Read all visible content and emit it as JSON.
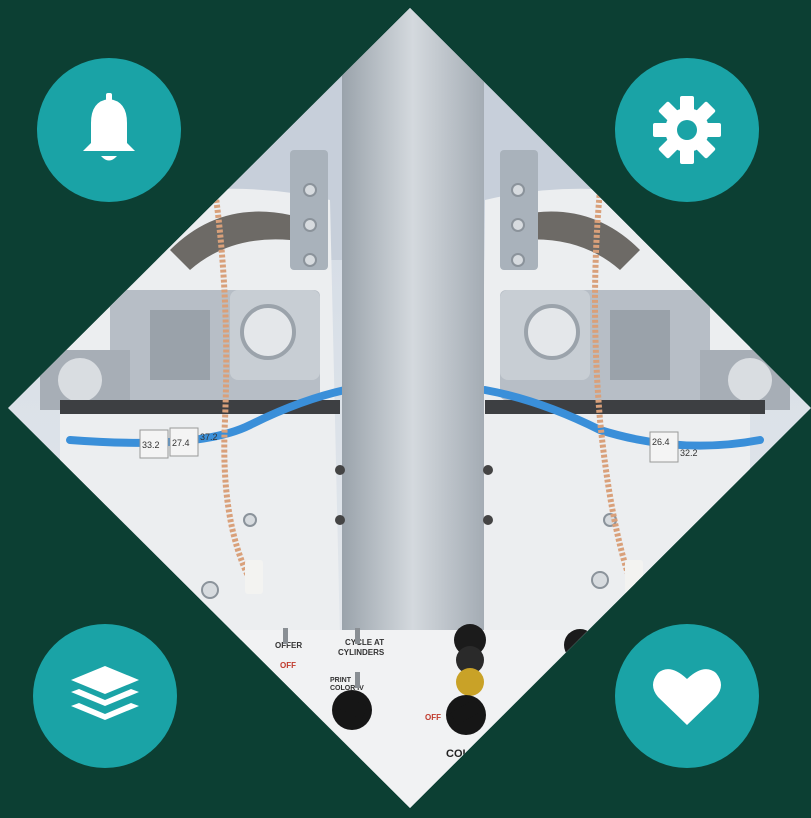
{
  "colors": {
    "background": "#0c3f33",
    "accent": "#1aa3a6",
    "icon": "#ffffff",
    "machine_body": "#e9ebee",
    "steel": "#b9c0c8",
    "cable_blue": "#3a8fd9"
  },
  "buttons": [
    {
      "id": "bell",
      "icon": "bell-icon"
    },
    {
      "id": "gear",
      "icon": "gear-icon"
    },
    {
      "id": "layers",
      "icon": "layers-icon"
    },
    {
      "id": "heart",
      "icon": "heart-icon"
    }
  ],
  "panel_labels": {
    "left_top": "OFFER",
    "left_off": "OFF",
    "center_top": "CYCLE AT",
    "center_sub": "CYLINDERS",
    "print": "PRINT",
    "color_iv": "COLOR IV",
    "col": "COLO",
    "off_red": "OFF",
    "tag_left_1": "33.2",
    "tag_left_2": "27.4",
    "tag_left_3": "37.2",
    "tag_right_1": "26.4",
    "tag_right_2": "32.2"
  }
}
